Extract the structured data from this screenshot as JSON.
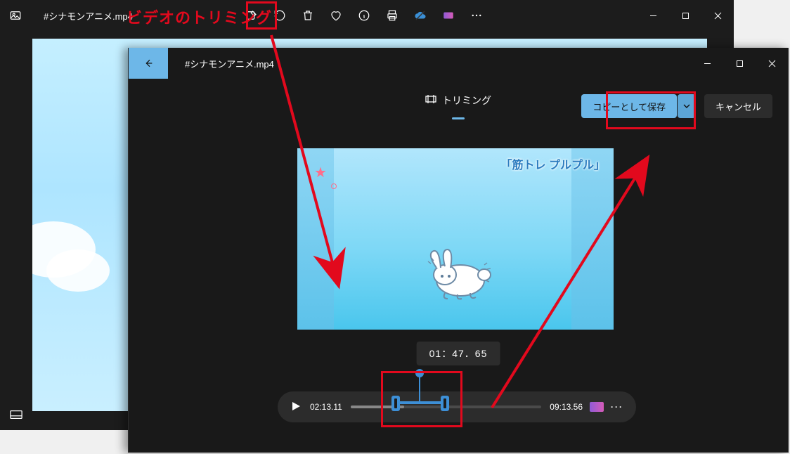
{
  "annotation": {
    "text": "ビデオのトリミング"
  },
  "back_window": {
    "title": "#シナモンアニメ.mp4",
    "tools": [
      "edit-image",
      "rotate",
      "delete",
      "favorite",
      "info",
      "print",
      "cloud",
      "clipchamp",
      "more"
    ]
  },
  "front_window": {
    "title": "#シナモンアニメ.mp4",
    "header": {
      "trim_label": "トリミング",
      "save_copy": "コピーとして保存",
      "cancel": "キャンセル"
    },
    "preview": {
      "caption": "「筋トレ プルプル」"
    },
    "time_display": "01：47．65",
    "playbar": {
      "start_time": "02:13.11",
      "end_time": "09:13.56"
    }
  }
}
